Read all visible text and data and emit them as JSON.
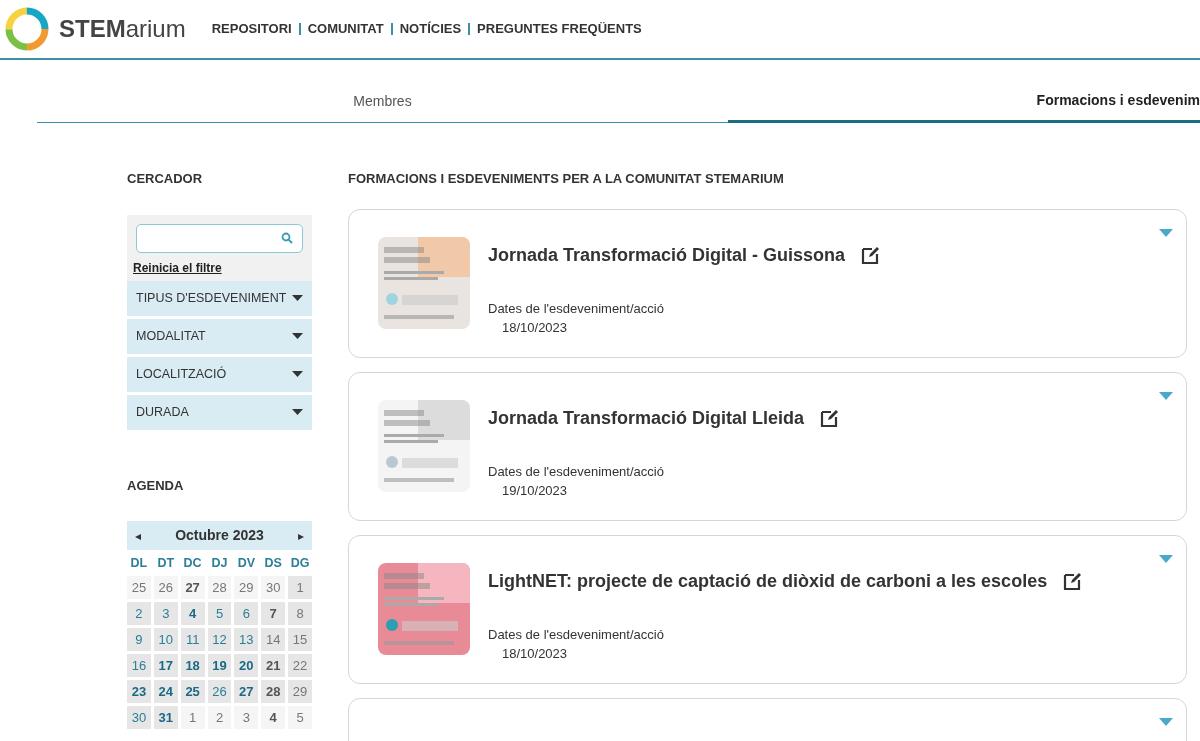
{
  "header": {
    "logo_bold": "STEM",
    "logo_light": "arium",
    "nav": [
      "REPOSITORI",
      "COMUNITAT",
      "NOTÍCIES",
      "PREGUNTES FREQÜENTS"
    ]
  },
  "tabs": [
    {
      "label": "Membres",
      "selected": false
    },
    {
      "label": "Formacions i esdevenim",
      "selected": true
    }
  ],
  "sidebar": {
    "search_title": "CERCADOR",
    "reset_link": "Reinicia el filtre",
    "filters": [
      {
        "label": "TIPUS D'ESDEVENIMENT",
        "expanded": false
      },
      {
        "label": "MODALITAT",
        "expanded": false
      },
      {
        "label": "LOCALITZACIÓ",
        "expanded": false
      },
      {
        "label": "DURADA",
        "expanded": false
      }
    ],
    "agenda_title": "AGENDA",
    "calendar": {
      "month": "Octubre 2023",
      "prev": "◂",
      "next": "▸",
      "weekdays": [
        "DL",
        "DT",
        "DC",
        "DJ",
        "DV",
        "DS",
        "DG"
      ],
      "weeks": [
        [
          {
            "day": "25",
            "kind": "plain",
            "outside": true
          },
          {
            "day": "26",
            "kind": "plain",
            "outside": true
          },
          {
            "day": "27",
            "kind": "weekend-event",
            "outside": true
          },
          {
            "day": "28",
            "kind": "plain",
            "outside": true
          },
          {
            "day": "29",
            "kind": "plain",
            "outside": true
          },
          {
            "day": "30",
            "kind": "plain",
            "outside": true
          },
          {
            "day": "1",
            "kind": "plain",
            "outside": false
          }
        ],
        [
          {
            "day": "2",
            "kind": "weekday",
            "outside": false
          },
          {
            "day": "3",
            "kind": "weekday",
            "outside": false
          },
          {
            "day": "4",
            "kind": "event",
            "outside": false
          },
          {
            "day": "5",
            "kind": "weekday",
            "outside": false
          },
          {
            "day": "6",
            "kind": "weekday",
            "outside": false
          },
          {
            "day": "7",
            "kind": "weekend-event",
            "outside": false
          },
          {
            "day": "8",
            "kind": "plain",
            "outside": false
          }
        ],
        [
          {
            "day": "9",
            "kind": "weekday",
            "outside": false
          },
          {
            "day": "10",
            "kind": "weekday",
            "outside": false
          },
          {
            "day": "11",
            "kind": "weekday",
            "outside": false
          },
          {
            "day": "12",
            "kind": "weekday",
            "outside": false
          },
          {
            "day": "13",
            "kind": "weekday",
            "outside": false
          },
          {
            "day": "14",
            "kind": "plain",
            "outside": false
          },
          {
            "day": "15",
            "kind": "plain",
            "outside": false
          }
        ],
        [
          {
            "day": "16",
            "kind": "weekday",
            "outside": false
          },
          {
            "day": "17",
            "kind": "event",
            "outside": false
          },
          {
            "day": "18",
            "kind": "event",
            "outside": false
          },
          {
            "day": "19",
            "kind": "event",
            "outside": false
          },
          {
            "day": "20",
            "kind": "event",
            "outside": false
          },
          {
            "day": "21",
            "kind": "weekend-event",
            "outside": false
          },
          {
            "day": "22",
            "kind": "plain",
            "outside": false
          }
        ],
        [
          {
            "day": "23",
            "kind": "event",
            "outside": false
          },
          {
            "day": "24",
            "kind": "event",
            "outside": false
          },
          {
            "day": "25",
            "kind": "event",
            "outside": false
          },
          {
            "day": "26",
            "kind": "weekday",
            "outside": false
          },
          {
            "day": "27",
            "kind": "event",
            "outside": false
          },
          {
            "day": "28",
            "kind": "weekend-event",
            "outside": false
          },
          {
            "day": "29",
            "kind": "plain",
            "outside": false
          }
        ],
        [
          {
            "day": "30",
            "kind": "weekday",
            "outside": false
          },
          {
            "day": "31",
            "kind": "event",
            "outside": false
          },
          {
            "day": "1",
            "kind": "plain",
            "outside": true
          },
          {
            "day": "2",
            "kind": "plain",
            "outside": true
          },
          {
            "day": "3",
            "kind": "plain",
            "outside": true
          },
          {
            "day": "4",
            "kind": "weekend-event",
            "outside": true
          },
          {
            "day": "5",
            "kind": "plain",
            "outside": true
          }
        ]
      ]
    }
  },
  "main": {
    "title": "FORMACIONS I ESDEVENIMENTS PER A LA COMUNITAT STEMARIUM",
    "events": [
      {
        "title": "Jornada Transformació Digital - Guissona",
        "dates_label": "Dates de l'esdeveniment/acció",
        "date": "18/10/2023"
      },
      {
        "title": "Jornada Transformació Digital Lleida",
        "dates_label": "Dates de l'esdeveniment/acció",
        "date": "19/10/2023"
      },
      {
        "title": "LightNET: projecte de captació de diòxid de carboni a les escoles",
        "dates_label": "Dates de l'esdeveniment/acció",
        "date": "18/10/2023"
      }
    ]
  }
}
